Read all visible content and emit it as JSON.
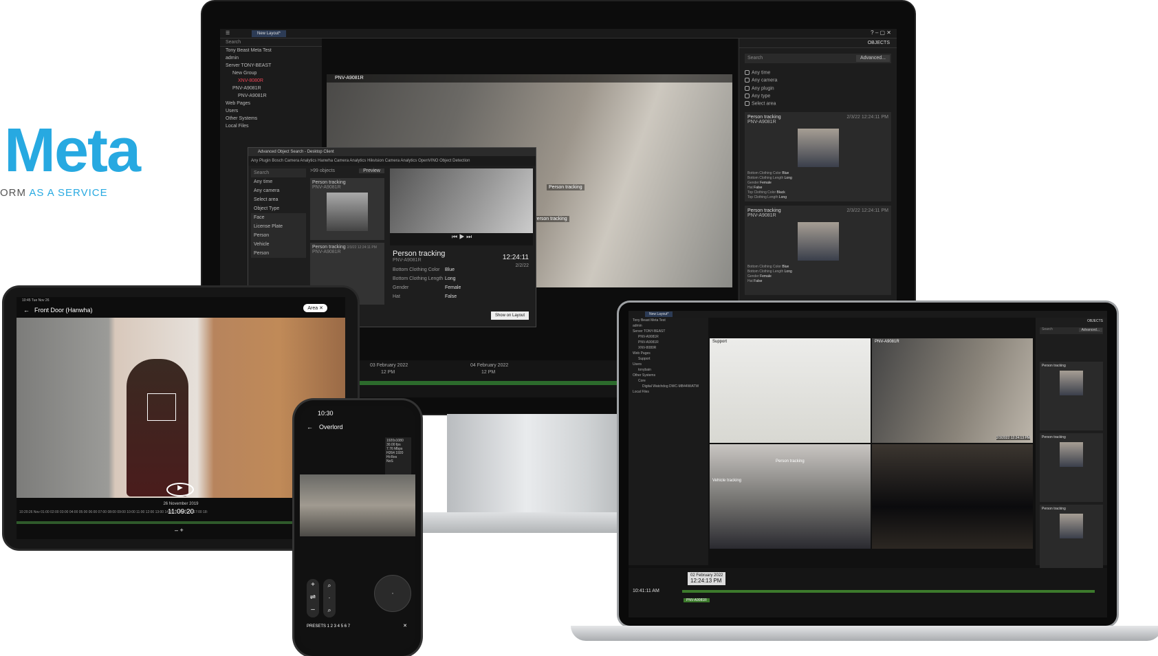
{
  "brand": {
    "title": "Meta",
    "tag_prefix": "ORM ",
    "tag_accent": "AS A SERVICE"
  },
  "monitor": {
    "tab": "New Layout*",
    "search_placeholder": "Search",
    "tree": [
      "Tony Beast Meta Test",
      "admin",
      "Server TONY-BEAST",
      "New Group",
      "XNV-8080R",
      "PNV-A9081R",
      "PNV-A9081R",
      "Web Pages",
      "Users",
      "Other Systems",
      "Local Files"
    ],
    "camera_title": "PNV-A9081R",
    "right": {
      "tab": "OBJECTS",
      "search": "Search",
      "advanced": "Advanced...",
      "filters": [
        "Any time",
        "Any camera",
        "Any plugin",
        "Any type",
        "Select area"
      ],
      "cards": [
        {
          "title": "Person tracking",
          "time": "2/3/22 12:24:11 PM",
          "camera": "PNV-A9081R",
          "attrs": [
            "Bottom Clothing Color",
            "Blue",
            "Bottom Clothing Length",
            "Long",
            "Gender",
            "Female",
            "Hat",
            "False",
            "Top Clothing Color",
            "Black",
            "Top Clothing Length",
            "Long"
          ]
        },
        {
          "title": "Person tracking",
          "time": "2/3/22 12:24:11 PM",
          "camera": "PNV-A9081R",
          "attrs": [
            "Bottom Clothing Color",
            "Blue",
            "Bottom Clothing Length",
            "Long",
            "Gender",
            "Female",
            "Hat",
            "False"
          ]
        }
      ]
    },
    "dialog": {
      "title": "Advanced Object Search - Desktop Client",
      "tabs": "Any Plugin   Bosch Camera Analytics   Hanwha Camera Analytics   Hikvision Camera Analytics   OpenVINO Object Detection",
      "search": "Search",
      "filters": [
        "Any time",
        "Any camera",
        "Select area",
        "Object Type",
        "Face",
        "License Plate",
        "Person",
        "Vehicle",
        "Person"
      ],
      "count": ">99 objects",
      "preview": "Preview",
      "items": [
        {
          "title": "Person tracking",
          "camera": "PNV-A9081R"
        },
        {
          "title": "Person tracking",
          "camera": "PNV-A9081R",
          "time": "2/3/22 12:24:11 PM"
        }
      ],
      "headline": "Person tracking",
      "time": "12:24:11",
      "date": "2/2/22",
      "camera": "PNV-A9081R",
      "attrs": [
        [
          "Bottom Clothing Color",
          "Blue"
        ],
        [
          "Bottom Clothing Length",
          "Long"
        ],
        [
          "Gender",
          "Female"
        ],
        [
          "Hat",
          "False"
        ]
      ],
      "show_button": "Show on Layout"
    },
    "timeline": {
      "d1": "03 February 2022",
      "d2": "04 February 2022",
      "t1": "12 PM",
      "t2": "12 PM"
    },
    "labels": {
      "l1": "Person tracking",
      "l2": "Person tracking"
    }
  },
  "tablet": {
    "status": "10:45 Tue Nov 26",
    "title": "Front Door (Hanwha)",
    "area": "Area",
    "date": "26 November 2019",
    "time": "11:09:20",
    "scale": "10:20:26 Nov  01:00  02:00  03:00  04:00  05:00  06:00  07:00  08:00  09:00  10:00  11:00  12:00  13:00  14:00  15:00  16:00  17:00  18:"
  },
  "phone": {
    "clock": "10:30",
    "title": "Overlord",
    "stats": [
      "1920x1080",
      "30.00 fps",
      "7.76 Mbps",
      "H264 1920",
      "Hi-Res",
      "NoS"
    ],
    "presets": "PRESETS  1  2  3  4  5  6  7"
  },
  "laptop": {
    "tab": "New Layout*",
    "tree": [
      "Tony Beast Meta Test",
      "admin",
      "Server TONY-BEAST",
      "PNV-A9081R",
      "PNV-A9081R",
      "XNV-8080R",
      "Web Pages",
      "Support",
      "Users",
      "tonybain",
      "Other Systems",
      "Core",
      "Digital Watchdog DWC-MB44WiATW",
      "Local Files"
    ],
    "cells": [
      "Support",
      "PNV-A9081R",
      "Vehicle tracking",
      "Person tracking"
    ],
    "cards": [
      "Person tracking",
      "Person tracking",
      "Person tracking"
    ],
    "tip_date": "02 February 2022",
    "tip_time": "12:24:13 PM",
    "clock": "10:41:11 AM",
    "camera": "PNV-A9081R",
    "right_tab": "OBJECTS",
    "search": "Search",
    "advanced": "Advanced...",
    "overlay_time": "2/3/2022 12:24:13 PM"
  }
}
